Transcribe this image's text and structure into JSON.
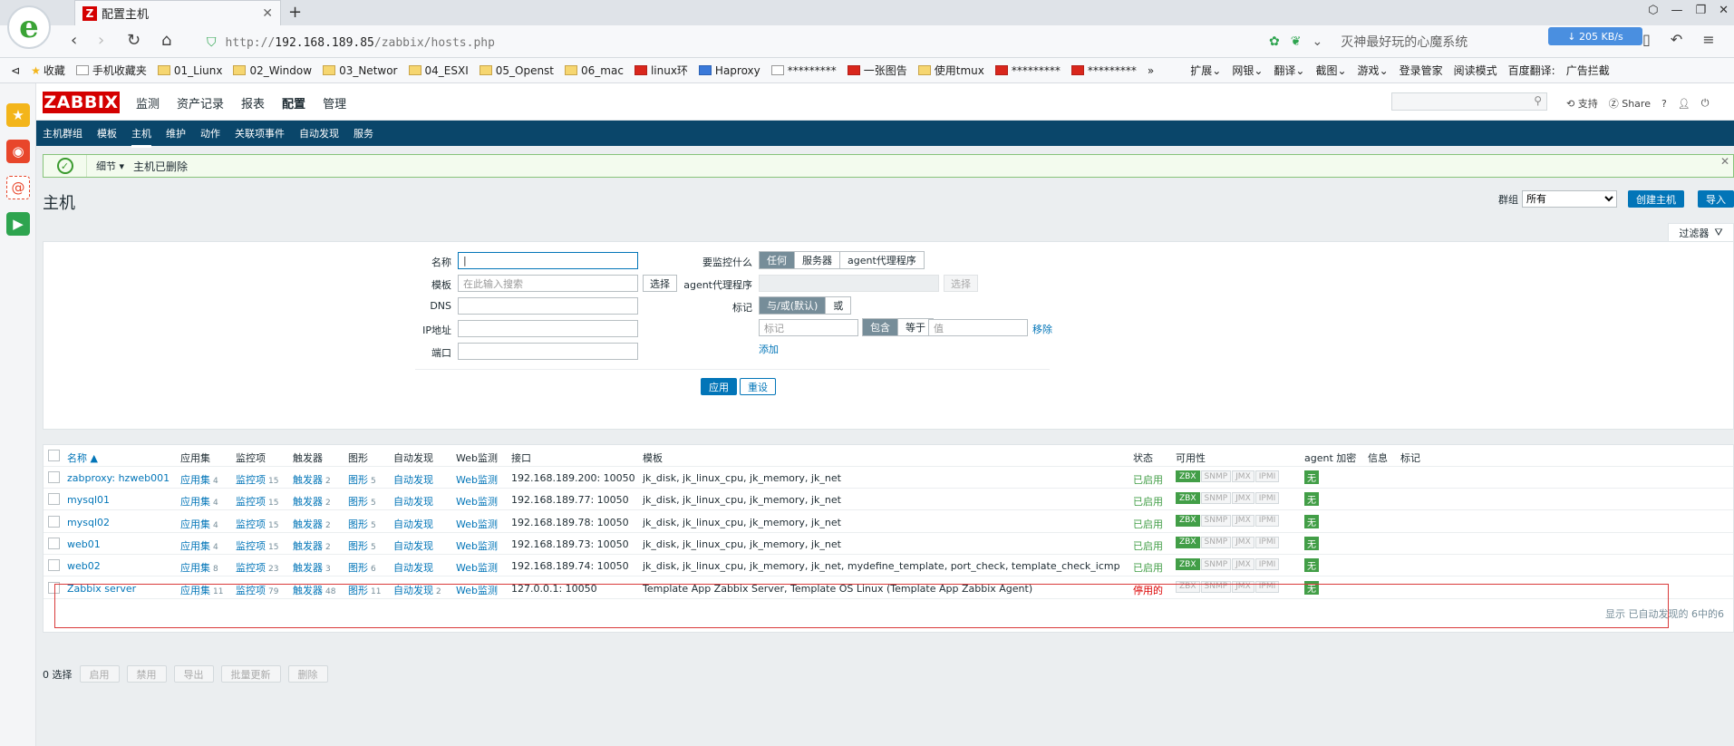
{
  "browser": {
    "tab_title": "配置主机",
    "tab_icon_letter": "Z",
    "url_protocol": "http://",
    "url_host": "192.168.189.85",
    "url_path": "/zabbix/hosts.php",
    "slogan": "灭神最好玩的心魔系统",
    "speed": "↓ 205 KB/s",
    "bookmarks": [
      "收藏",
      "手机收藏夹",
      "01_Liunx",
      "02_Window",
      "03_Networ",
      "04_ESXI",
      "05_Openst",
      "06_mac",
      "linux环",
      "Haproxy",
      "*********",
      "一张图告",
      "使用tmux",
      "*********",
      "*********",
      "扩展",
      "网银",
      "翻译",
      "截图",
      "游戏",
      "登录管家",
      "阅读模式",
      "百度翻译:",
      "广告拦截"
    ]
  },
  "zabbix": {
    "logo": "ZABBIX",
    "main_menu": [
      "监测",
      "资产记录",
      "报表",
      "配置",
      "管理"
    ],
    "active_main": "配置",
    "top_links": [
      "支持",
      "Share",
      "?"
    ],
    "sub_menu": [
      "主机群组",
      "模板",
      "主机",
      "维护",
      "动作",
      "关联项事件",
      "自动发现",
      "服务"
    ],
    "active_sub": "主机",
    "message": {
      "detail": "细节",
      "text": "主机已删除"
    },
    "page_title": "主机",
    "group_label": "群组",
    "group_value": "所有",
    "create_button": "创建主机",
    "import_button": "导入",
    "filter_tab": "过滤器"
  },
  "filter": {
    "name_label": "名称",
    "template_label": "模板",
    "template_placeholder": "在此输入搜索",
    "select_label": "选择",
    "dns_label": "DNS",
    "ip_label": "IP地址",
    "port_label": "端口",
    "monitored_by_label": "要监控什么",
    "monitored_by_options": [
      "任何",
      "服务器",
      "agent代理程序"
    ],
    "proxy_label": "agent代理程序",
    "tags_label": "标记",
    "tags_mode": [
      "与/或(默认)",
      "或"
    ],
    "tag_placeholder": "标记",
    "tag_ops": [
      "包含",
      "等于"
    ],
    "value_placeholder": "值",
    "remove_label": "移除",
    "add_label": "添加",
    "apply_label": "应用",
    "reset_label": "重设"
  },
  "table": {
    "headers": [
      "名称 ▲",
      "应用集",
      "监控项",
      "触发器",
      "图形",
      "自动发现",
      "Web监测",
      "接口",
      "模板",
      "状态",
      "可用性",
      "agent 加密",
      "信息",
      "标记"
    ],
    "app_label": "应用集",
    "item_label": "监控项",
    "trigger_label": "触发器",
    "graph_label": "图形",
    "discovery_label": "自动发现",
    "web_label": "Web监测",
    "avail_labels": [
      "ZBX",
      "SNMP",
      "JMX",
      "IPMI"
    ],
    "rows": [
      {
        "name": "zabproxy: hzweb001",
        "apps": "4",
        "items": "15",
        "triggers": "2",
        "graphs": "5",
        "discovery": "",
        "iface": "192.168.189.200: 10050",
        "templates": "jk_disk, jk_linux_cpu, jk_memory, jk_net",
        "status": "已启用",
        "enc": "无"
      },
      {
        "name": "mysql01",
        "apps": "4",
        "items": "15",
        "triggers": "2",
        "graphs": "5",
        "discovery": "",
        "iface": "192.168.189.77: 10050",
        "templates": "jk_disk, jk_linux_cpu, jk_memory, jk_net",
        "status": "已启用",
        "enc": "无"
      },
      {
        "name": "mysql02",
        "apps": "4",
        "items": "15",
        "triggers": "2",
        "graphs": "5",
        "discovery": "",
        "iface": "192.168.189.78: 10050",
        "templates": "jk_disk, jk_linux_cpu, jk_memory, jk_net",
        "status": "已启用",
        "enc": "无"
      },
      {
        "name": "web01",
        "apps": "4",
        "items": "15",
        "triggers": "2",
        "graphs": "5",
        "discovery": "",
        "iface": "192.168.189.73: 10050",
        "templates": "jk_disk, jk_linux_cpu, jk_memory, jk_net",
        "status": "已启用",
        "enc": "无"
      },
      {
        "name": "web02",
        "apps": "8",
        "items": "23",
        "triggers": "3",
        "graphs": "6",
        "discovery": "",
        "iface": "192.168.189.74: 10050",
        "templates": "jk_disk, jk_linux_cpu, jk_memory, jk_net, mydefine_template, port_check, template_check_icmp",
        "status": "已启用",
        "enc": "无"
      },
      {
        "name": "Zabbix server",
        "apps": "11",
        "items": "79",
        "triggers": "48",
        "graphs": "11",
        "discovery": "2",
        "iface": "127.0.0.1: 10050",
        "templates": "Template App Zabbix Server, Template OS Linux (Template App Zabbix Agent)",
        "status": "停用的",
        "enc": "无"
      }
    ],
    "footer": "显示 已自动发现的 6中的6"
  },
  "actions": {
    "selected": "0 选择",
    "buttons": [
      "启用",
      "禁用",
      "导出",
      "批量更新",
      "删除"
    ]
  },
  "colors": {
    "brand": "#d40000",
    "nav": "#0a466a",
    "link": "#0275b8",
    "enabled": "#429e47",
    "disabled": "#dc0000"
  }
}
